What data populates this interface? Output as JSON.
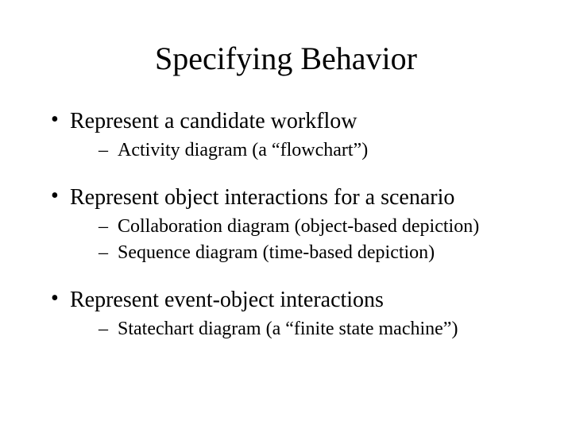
{
  "title": "Specifying Behavior",
  "bullets": [
    {
      "text": "Represent a candidate workflow",
      "subs": [
        "Activity diagram (a “flowchart”)"
      ]
    },
    {
      "text": "Represent object interactions for a scenario",
      "subs": [
        "Collaboration diagram (object-based depiction)",
        "Sequence diagram (time-based depiction)"
      ]
    },
    {
      "text": "Represent event-object interactions",
      "subs": [
        "Statechart diagram (a “finite state machine”)"
      ]
    }
  ]
}
